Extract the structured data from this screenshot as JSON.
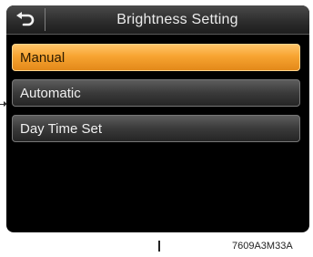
{
  "header": {
    "title": "Brightness Setting",
    "back_icon": "back-arrow-icon"
  },
  "menu": {
    "items": [
      {
        "label": "Manual",
        "selected": true
      },
      {
        "label": "Automatic",
        "selected": false
      },
      {
        "label": "Day Time Set",
        "selected": false
      }
    ]
  },
  "figure": {
    "caption": "7609A3M33A"
  },
  "colors": {
    "selected_item": "#f7a431",
    "normal_item": "#3a3a3a",
    "screen_background": "#000000",
    "text_light": "#f0f0f0"
  }
}
